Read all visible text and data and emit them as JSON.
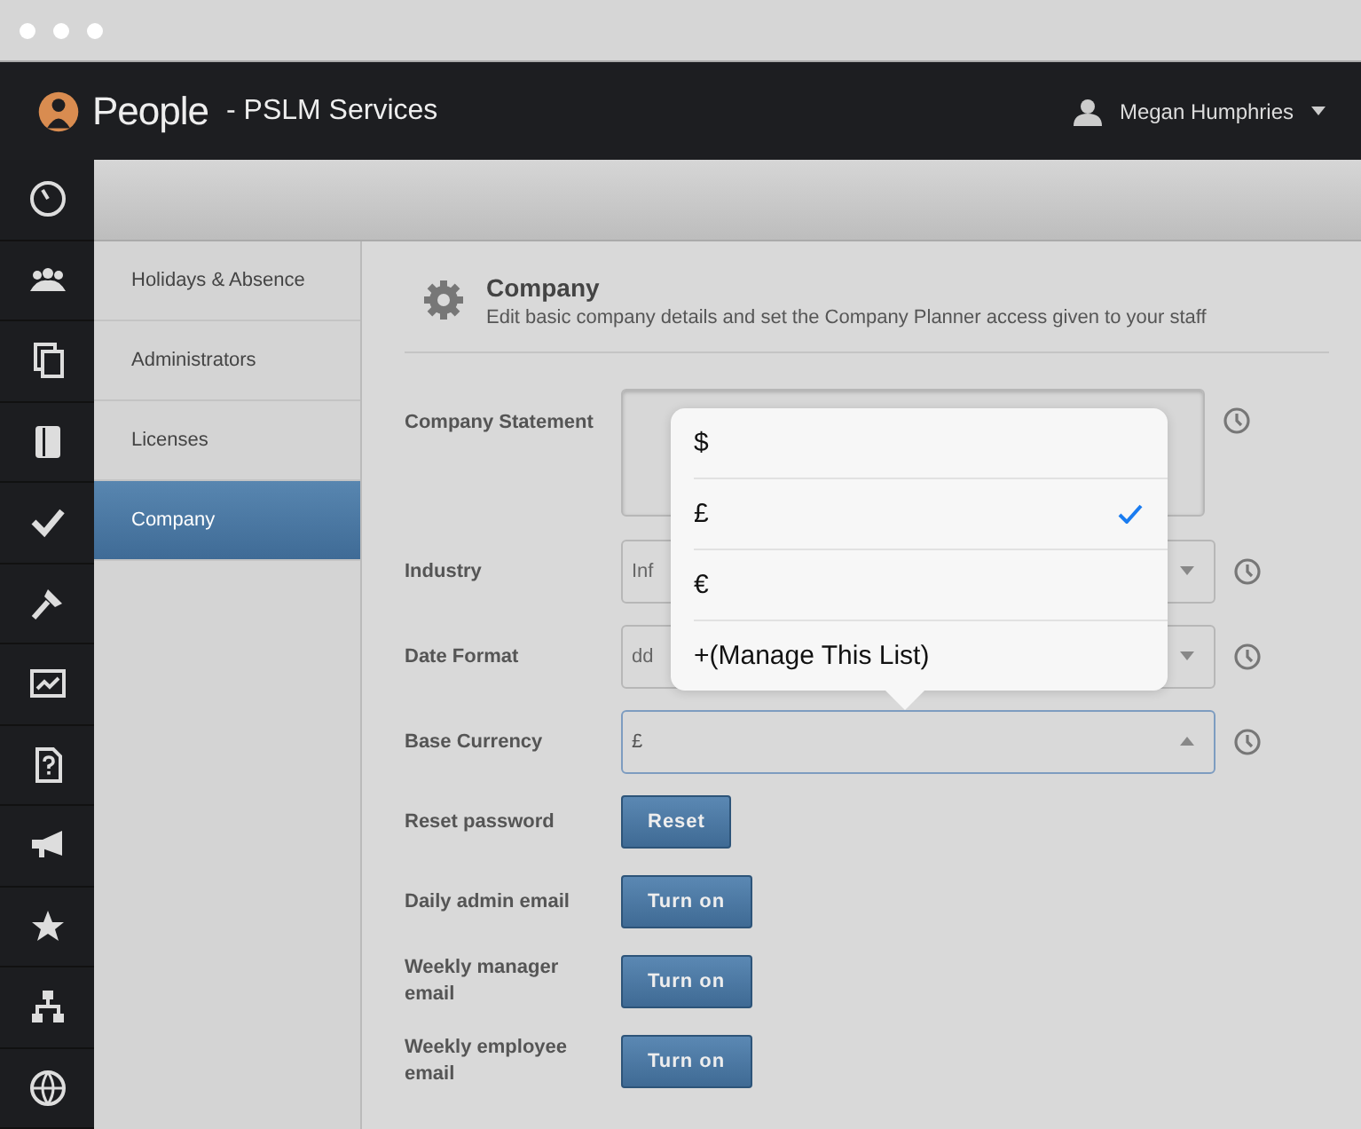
{
  "app": {
    "name": "People",
    "subtitle": "- PSLM Services",
    "user": "Megan Humphries"
  },
  "submenu": [
    {
      "label": "Holidays & Absence",
      "selected": false
    },
    {
      "label": "Administrators",
      "selected": false
    },
    {
      "label": "Licenses",
      "selected": false
    },
    {
      "label": "Company",
      "selected": true
    }
  ],
  "section": {
    "title": "Company",
    "description": "Edit basic company details and set the Company Planner access given to your staff"
  },
  "form": [
    {
      "kind": "textarea",
      "label": "Company Statement"
    },
    {
      "kind": "select",
      "label": "Industry",
      "value": "Inf",
      "focused": false
    },
    {
      "kind": "select",
      "label": "Date Format",
      "value": "dd",
      "focused": false
    },
    {
      "kind": "select",
      "label": "Base Currency",
      "value": "£",
      "focused": true
    },
    {
      "kind": "button",
      "label": "Reset password",
      "button": "Reset"
    },
    {
      "kind": "button",
      "label": "Daily admin email",
      "button": "Turn on"
    },
    {
      "kind": "button",
      "label": "Weekly manager email",
      "button": "Turn on"
    },
    {
      "kind": "button",
      "label": "Weekly employee email",
      "button": "Turn on"
    }
  ],
  "currency_menu": [
    {
      "label": "$",
      "selected": false
    },
    {
      "label": "£",
      "selected": true
    },
    {
      "label": "€",
      "selected": false
    },
    {
      "label": "+(Manage This List)",
      "selected": false
    }
  ]
}
